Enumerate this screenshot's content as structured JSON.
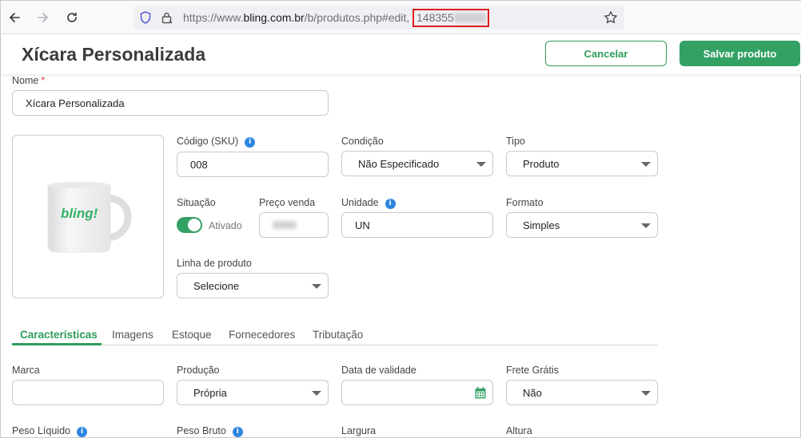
{
  "browser": {
    "url_prefix": "https://www.",
    "url_host": "bling.com.br",
    "url_path": "/b/produtos.php#edit,",
    "url_id": "148355"
  },
  "header": {
    "title": "Xícara Personalizada",
    "cancel_label": "Cancelar",
    "save_label": "Salvar produto"
  },
  "form": {
    "nome": {
      "label": "Nome",
      "required": "*",
      "value": "Xícara Personalizada"
    },
    "sku": {
      "label": "Código (SKU)",
      "value": "008"
    },
    "condicao": {
      "label": "Condição",
      "value": "Não Especificado"
    },
    "tipo": {
      "label": "Tipo",
      "value": "Produto"
    },
    "situacao": {
      "label": "Situação",
      "value": "Ativado"
    },
    "preco": {
      "label": "Preço venda",
      "value": ""
    },
    "unidade": {
      "label": "Unidade",
      "value": "UN"
    },
    "formato": {
      "label": "Formato",
      "value": "Simples"
    },
    "linha": {
      "label": "Linha de produto",
      "value": "Selecione"
    },
    "image_brand": "bling!"
  },
  "tabs": [
    {
      "label": "Características",
      "active": true
    },
    {
      "label": "Imagens"
    },
    {
      "label": "Estoque"
    },
    {
      "label": "Fornecedores"
    },
    {
      "label": "Tributação"
    }
  ],
  "caracteristicas": {
    "marca": {
      "label": "Marca",
      "value": ""
    },
    "producao": {
      "label": "Produção",
      "value": "Própria"
    },
    "validade": {
      "label": "Data de validade",
      "value": ""
    },
    "frete": {
      "label": "Frete Grátis",
      "value": "Não"
    },
    "peso_liquido": {
      "label": "Peso Líquido"
    },
    "peso_bruto": {
      "label": "Peso Bruto"
    },
    "largura": {
      "label": "Largura"
    },
    "altura": {
      "label": "Altura"
    }
  },
  "colors": {
    "accent": "#33a164",
    "info": "#2e86de",
    "highlight": "#e01e1e"
  }
}
